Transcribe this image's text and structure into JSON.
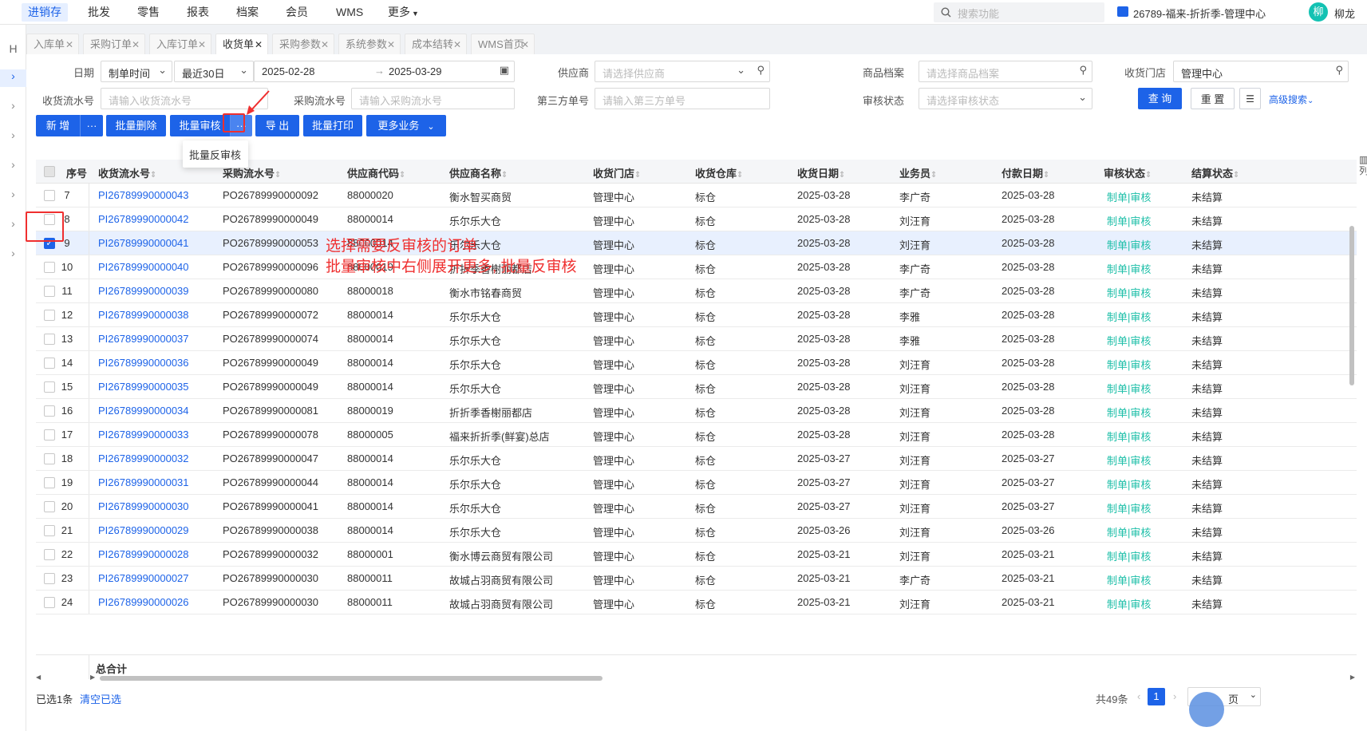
{
  "top_nav": {
    "items": [
      "进销存",
      "批发",
      "零售",
      "报表",
      "档案",
      "会员",
      "WMS",
      "更多"
    ],
    "search_placeholder": "搜索功能",
    "store": "26789-福来-折折季-管理中心",
    "avatar_char": "柳",
    "user": "柳龙"
  },
  "tabs": [
    "入库单",
    "采购订单",
    "入库订单",
    "收货单",
    "采购参数",
    "系统参数",
    "成本结转",
    "WMS首页"
  ],
  "filters": {
    "date_label": "日期",
    "date_type": "制单时间",
    "date_range": "最近30日",
    "date_start": "2025-02-28",
    "date_end": "2025-03-29",
    "supplier_label": "供应商",
    "supplier_ph": "请选择供应商",
    "goods_label": "商品档案",
    "goods_ph": "请选择商品档案",
    "store_label": "收货门店",
    "store_value": "管理中心",
    "receipt_no_label": "收货流水号",
    "receipt_no_ph": "请输入收货流水号",
    "po_no_label": "采购流水号",
    "po_no_ph": "请输入采购流水号",
    "third_no_label": "第三方单号",
    "third_no_ph": "请输入第三方单号",
    "audit_label": "审核状态",
    "audit_ph": "请选择审核状态",
    "query": "查 询",
    "reset": "重 置",
    "advanced": "高级搜索"
  },
  "toolbar": {
    "add": "新 增",
    "more_dots": "···",
    "batch_delete": "批量删除",
    "batch_audit": "批量审核",
    "export": "导 出",
    "batch_print": "批量打印",
    "more_biz": "更多业务",
    "dropdown_item": "批量反审核"
  },
  "table": {
    "headers": [
      "序号",
      "收货流水号",
      "采购流水号",
      "供应商代码",
      "供应商名称",
      "收货门店",
      "收货仓库",
      "收货日期",
      "业务员",
      "付款日期",
      "审核状态",
      "结算状态"
    ],
    "rows": [
      {
        "no": "7",
        "id": "PI26789990000043",
        "po": "PO26789990000092",
        "code": "88000020",
        "supplier": "衡水智买商贸",
        "store": "管理中心",
        "wh": "标仓",
        "date": "2025-03-28",
        "staff": "李广奇",
        "pay": "2025-03-28",
        "audit": "制单|审核",
        "settle": "未结算",
        "checked": false
      },
      {
        "no": "8",
        "id": "PI26789990000042",
        "po": "PO26789990000049",
        "code": "88000014",
        "supplier": "乐尔乐大仓",
        "store": "管理中心",
        "wh": "标仓",
        "date": "2025-03-28",
        "staff": "刘汪育",
        "pay": "2025-03-28",
        "audit": "制单|审核",
        "settle": "未结算",
        "checked": false
      },
      {
        "no": "9",
        "id": "PI26789990000041",
        "po": "PO26789990000053",
        "code": "88000014",
        "supplier": "乐尔乐大仓",
        "store": "管理中心",
        "wh": "标仓",
        "date": "2025-03-28",
        "staff": "刘汪育",
        "pay": "2025-03-28",
        "audit": "制单|审核",
        "settle": "未结算",
        "checked": true
      },
      {
        "no": "10",
        "id": "PI26789990000040",
        "po": "PO26789990000096",
        "code": "88000019",
        "supplier": "折折季香榭丽都店",
        "store": "管理中心",
        "wh": "标仓",
        "date": "2025-03-28",
        "staff": "李广奇",
        "pay": "2025-03-28",
        "audit": "制单|审核",
        "settle": "未结算",
        "checked": false
      },
      {
        "no": "11",
        "id": "PI26789990000039",
        "po": "PO26789990000080",
        "code": "88000018",
        "supplier": "衡水市铭春商贸",
        "store": "管理中心",
        "wh": "标仓",
        "date": "2025-03-28",
        "staff": "李广奇",
        "pay": "2025-03-28",
        "audit": "制单|审核",
        "settle": "未结算",
        "checked": false
      },
      {
        "no": "12",
        "id": "PI26789990000038",
        "po": "PO26789990000072",
        "code": "88000014",
        "supplier": "乐尔乐大仓",
        "store": "管理中心",
        "wh": "标仓",
        "date": "2025-03-28",
        "staff": "李雅",
        "pay": "2025-03-28",
        "audit": "制单|审核",
        "settle": "未结算",
        "checked": false
      },
      {
        "no": "13",
        "id": "PI26789990000037",
        "po": "PO26789990000074",
        "code": "88000014",
        "supplier": "乐尔乐大仓",
        "store": "管理中心",
        "wh": "标仓",
        "date": "2025-03-28",
        "staff": "李雅",
        "pay": "2025-03-28",
        "audit": "制单|审核",
        "settle": "未结算",
        "checked": false
      },
      {
        "no": "14",
        "id": "PI26789990000036",
        "po": "PO26789990000049",
        "code": "88000014",
        "supplier": "乐尔乐大仓",
        "store": "管理中心",
        "wh": "标仓",
        "date": "2025-03-28",
        "staff": "刘汪育",
        "pay": "2025-03-28",
        "audit": "制单|审核",
        "settle": "未结算",
        "checked": false
      },
      {
        "no": "15",
        "id": "PI26789990000035",
        "po": "PO26789990000049",
        "code": "88000014",
        "supplier": "乐尔乐大仓",
        "store": "管理中心",
        "wh": "标仓",
        "date": "2025-03-28",
        "staff": "刘汪育",
        "pay": "2025-03-28",
        "audit": "制单|审核",
        "settle": "未结算",
        "checked": false
      },
      {
        "no": "16",
        "id": "PI26789990000034",
        "po": "PO26789990000081",
        "code": "88000019",
        "supplier": "折折季香榭丽都店",
        "store": "管理中心",
        "wh": "标仓",
        "date": "2025-03-28",
        "staff": "刘汪育",
        "pay": "2025-03-28",
        "audit": "制单|审核",
        "settle": "未结算",
        "checked": false
      },
      {
        "no": "17",
        "id": "PI26789990000033",
        "po": "PO26789990000078",
        "code": "88000005",
        "supplier": "福来折折季(鲜宴)总店",
        "store": "管理中心",
        "wh": "标仓",
        "date": "2025-03-28",
        "staff": "刘汪育",
        "pay": "2025-03-28",
        "audit": "制单|审核",
        "settle": "未结算",
        "checked": false
      },
      {
        "no": "18",
        "id": "PI26789990000032",
        "po": "PO26789990000047",
        "code": "88000014",
        "supplier": "乐尔乐大仓",
        "store": "管理中心",
        "wh": "标仓",
        "date": "2025-03-27",
        "staff": "刘汪育",
        "pay": "2025-03-27",
        "audit": "制单|审核",
        "settle": "未结算",
        "checked": false
      },
      {
        "no": "19",
        "id": "PI26789990000031",
        "po": "PO26789990000044",
        "code": "88000014",
        "supplier": "乐尔乐大仓",
        "store": "管理中心",
        "wh": "标仓",
        "date": "2025-03-27",
        "staff": "刘汪育",
        "pay": "2025-03-27",
        "audit": "制单|审核",
        "settle": "未结算",
        "checked": false
      },
      {
        "no": "20",
        "id": "PI26789990000030",
        "po": "PO26789990000041",
        "code": "88000014",
        "supplier": "乐尔乐大仓",
        "store": "管理中心",
        "wh": "标仓",
        "date": "2025-03-27",
        "staff": "刘汪育",
        "pay": "2025-03-27",
        "audit": "制单|审核",
        "settle": "未结算",
        "checked": false
      },
      {
        "no": "21",
        "id": "PI26789990000029",
        "po": "PO26789990000038",
        "code": "88000014",
        "supplier": "乐尔乐大仓",
        "store": "管理中心",
        "wh": "标仓",
        "date": "2025-03-26",
        "staff": "刘汪育",
        "pay": "2025-03-26",
        "audit": "制单|审核",
        "settle": "未结算",
        "checked": false
      },
      {
        "no": "22",
        "id": "PI26789990000028",
        "po": "PO26789990000032",
        "code": "88000001",
        "supplier": "衡水博云商贸有限公司",
        "store": "管理中心",
        "wh": "标仓",
        "date": "2025-03-21",
        "staff": "刘汪育",
        "pay": "2025-03-21",
        "audit": "制单|审核",
        "settle": "未结算",
        "checked": false
      },
      {
        "no": "23",
        "id": "PI26789990000027",
        "po": "PO26789990000030",
        "code": "88000011",
        "supplier": "故城占羽商贸有限公司",
        "store": "管理中心",
        "wh": "标仓",
        "date": "2025-03-21",
        "staff": "李广奇",
        "pay": "2025-03-21",
        "audit": "制单|审核",
        "settle": "未结算",
        "checked": false
      },
      {
        "no": "24",
        "id": "PI26789990000026",
        "po": "PO26789990000030",
        "code": "88000011",
        "supplier": "故城占羽商贸有限公司",
        "store": "管理中心",
        "wh": "标仓",
        "date": "2025-03-21",
        "staff": "刘汪育",
        "pay": "2025-03-21",
        "audit": "制单|审核",
        "settle": "未结算",
        "checked": false
      }
    ],
    "total_label": "总合计",
    "col_setting": "列"
  },
  "footer": {
    "selected": "已选1条",
    "clear": "清空已选",
    "total": "共49条",
    "page": "1",
    "page_size": "页"
  },
  "annotation": {
    "line1": "选择需要反审核的订单",
    "line2": "批量审核中右侧展开更多, 批量反审核"
  },
  "colors": {
    "primary": "#1d63e8",
    "status": "#1dbfa8",
    "annotation": "#ef2f2f"
  }
}
